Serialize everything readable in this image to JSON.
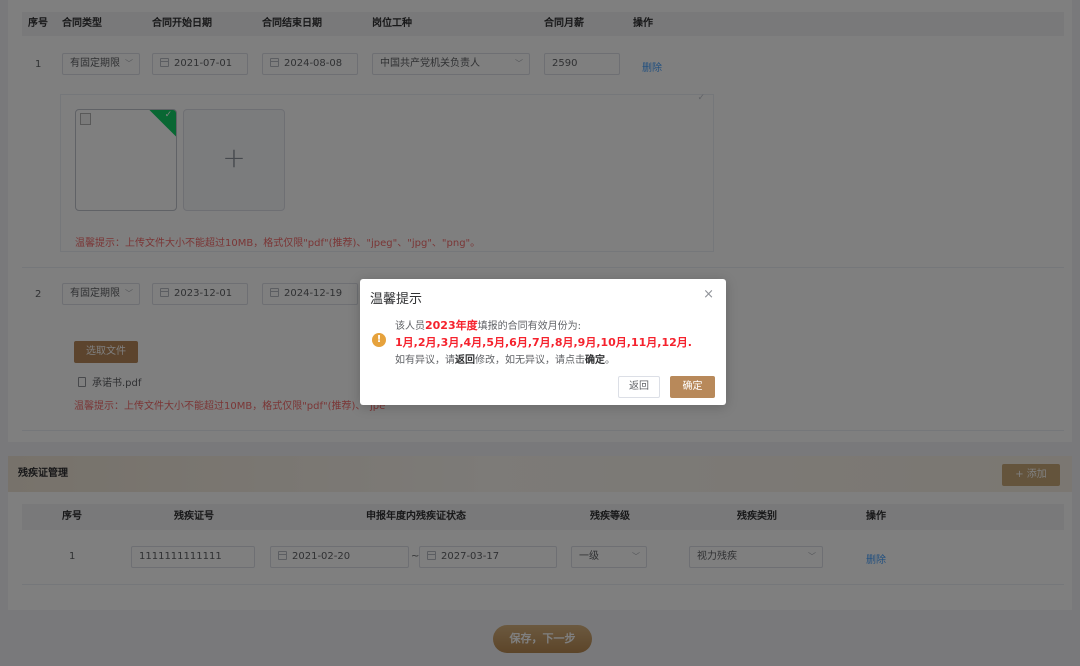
{
  "contracts": {
    "headers": [
      "序号",
      "合同类型",
      "合同开始日期",
      "合同结束日期",
      "岗位工种",
      "合同月薪",
      "操作"
    ],
    "rows": [
      {
        "index": "1",
        "type": "有固定期限",
        "start": "2021-07-01",
        "end": "2024-08-08",
        "position": "中国共产党机关负责人",
        "salary": "2590",
        "action": "删除"
      },
      {
        "index": "2",
        "type": "有固定期限",
        "start": "2023-12-01",
        "end": "2024-12-19"
      }
    ],
    "upload_tip": "温馨提示：上传文件大小不能超过10MB，格式仅限\"pdf\"(推荐)、\"jpeg\"、\"jpg\"、\"png\"。",
    "upload_tip_partial": "温馨提示：上传文件大小不能超过10MB，格式仅限\"pdf\"(推荐)、\"jpe",
    "select_file": "选取文件",
    "file_name": "承诺书.pdf",
    "adder_symbol": "+",
    "check_mark": "✓"
  },
  "disability": {
    "title": "残疾证管理",
    "add_label": "+ 添加",
    "headers": [
      "序号",
      "残疾证号",
      "申报年度内残疾证状态",
      "残疾等级",
      "残疾类别",
      "操作"
    ],
    "row": {
      "index": "1",
      "cert_no": "1111111111111",
      "start": "2021-02-20",
      "sep": "~",
      "end": "2027-03-17",
      "level": "一级",
      "category": "视力残疾",
      "action": "删除"
    }
  },
  "save_label": "保存，下一步",
  "dialog": {
    "title": "温馨提示",
    "close": "×",
    "warn_icon": "!",
    "line1_pre": "该人员",
    "line1_year": "2023年度",
    "line1_post": "填报的合同有效月份为:",
    "months": "1月,2月,3月,4月,5月,6月,7月,8月,9月,10月,11月,12月.",
    "line3_a": "如有异议，请",
    "line3_back": "返回",
    "line3_b": "修改，如无异议，请点击",
    "line3_ok": "确定",
    "line3_c": "。",
    "btn_back": "返回",
    "btn_ok": "确定"
  },
  "colors": {
    "accent": "#b8895a",
    "link": "#409eff",
    "warning": "#e6a23c",
    "danger": "#f5222d"
  }
}
